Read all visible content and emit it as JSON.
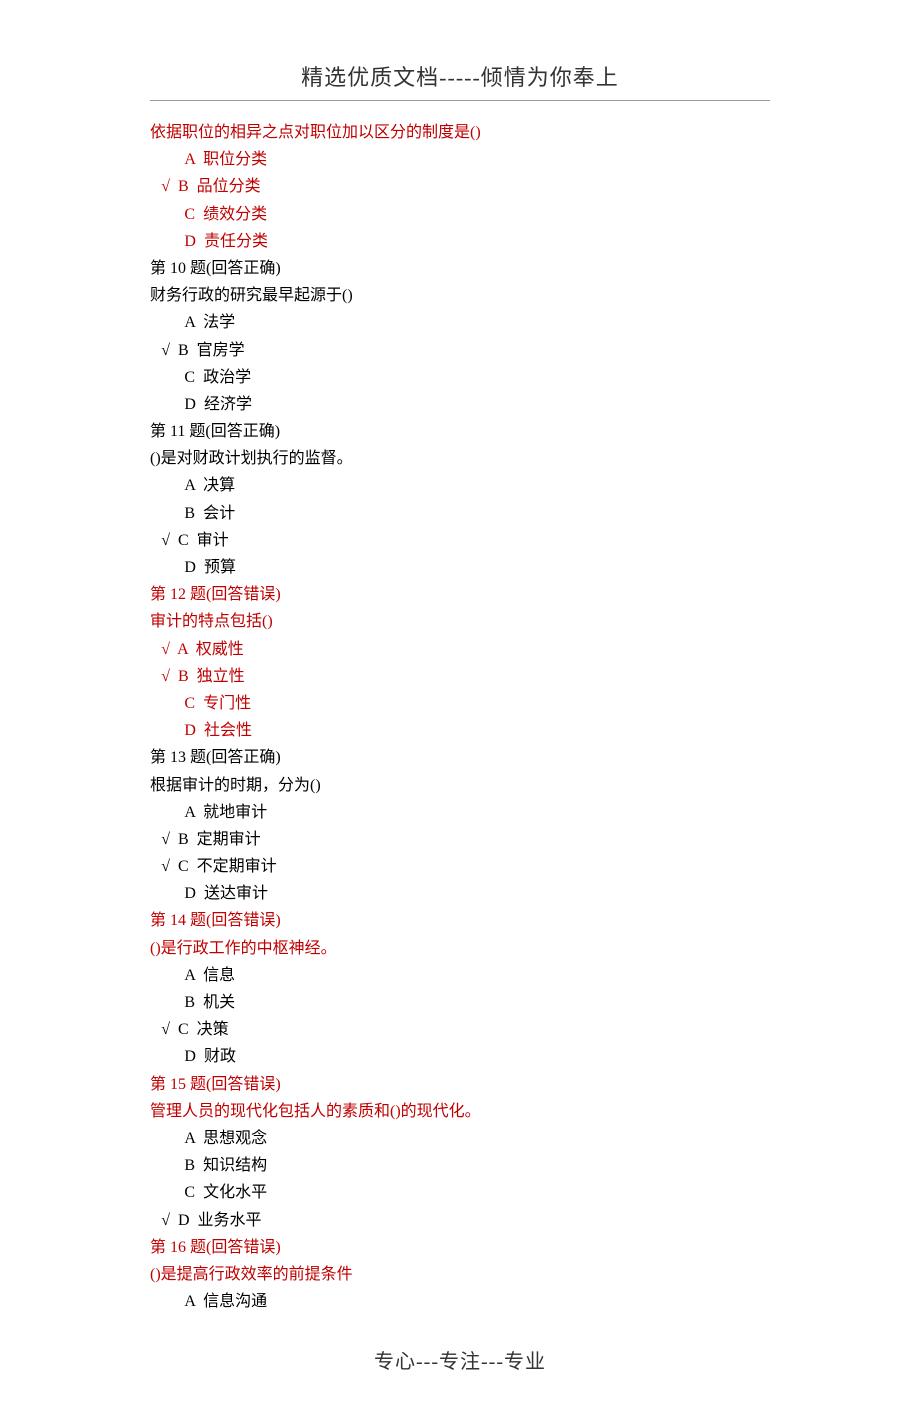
{
  "header": "精选优质文档-----倾情为你奉上",
  "footer": "专心---专注---专业",
  "orphan_question": {
    "text": "依据职位的相异之点对职位加以区分的制度是()",
    "text_color": "red",
    "options": [
      {
        "label": "A",
        "text": "职位分类",
        "marked": false,
        "color": "red"
      },
      {
        "label": "B",
        "text": "品位分类",
        "marked": true,
        "color": "red"
      },
      {
        "label": "C",
        "text": "绩效分类",
        "marked": false,
        "color": "red"
      },
      {
        "label": "D",
        "text": "责任分类",
        "marked": false,
        "color": "red"
      }
    ]
  },
  "questions": [
    {
      "header": "第 10 题(回答正确)",
      "header_color": "black",
      "text": "财务行政的研究最早起源于()",
      "text_color": "black",
      "options": [
        {
          "label": "A",
          "text": "法学",
          "marked": false,
          "color": "black"
        },
        {
          "label": "B",
          "text": "官房学",
          "marked": true,
          "color": "black"
        },
        {
          "label": "C",
          "text": "政治学",
          "marked": false,
          "color": "black"
        },
        {
          "label": "D",
          "text": "经济学",
          "marked": false,
          "color": "black"
        }
      ]
    },
    {
      "header": "第 11 题(回答正确)",
      "header_color": "black",
      "text": "()是对财政计划执行的监督。",
      "text_color": "black",
      "options": [
        {
          "label": "A",
          "text": "决算",
          "marked": false,
          "color": "black"
        },
        {
          "label": "B",
          "text": "会计",
          "marked": false,
          "color": "black"
        },
        {
          "label": "C",
          "text": "审计",
          "marked": true,
          "color": "black"
        },
        {
          "label": "D",
          "text": "预算",
          "marked": false,
          "color": "black"
        }
      ]
    },
    {
      "header": "第 12 题(回答错误)",
      "header_color": "red",
      "text": "审计的特点包括()",
      "text_color": "red",
      "options": [
        {
          "label": "A",
          "text": "权威性",
          "marked": true,
          "color": "red"
        },
        {
          "label": "B",
          "text": "独立性",
          "marked": true,
          "color": "red"
        },
        {
          "label": "C",
          "text": "专门性",
          "marked": false,
          "color": "red"
        },
        {
          "label": "D",
          "text": "社会性",
          "marked": false,
          "color": "red"
        }
      ]
    },
    {
      "header": "第 13 题(回答正确)",
      "header_color": "black",
      "text": "根据审计的时期，分为()",
      "text_color": "black",
      "options": [
        {
          "label": "A",
          "text": "就地审计",
          "marked": false,
          "color": "black"
        },
        {
          "label": "B",
          "text": "定期审计",
          "marked": true,
          "color": "black"
        },
        {
          "label": "C",
          "text": "不定期审计",
          "marked": true,
          "color": "black"
        },
        {
          "label": "D",
          "text": "送达审计",
          "marked": false,
          "color": "black"
        }
      ]
    },
    {
      "header": "第 14 题(回答错误)",
      "header_color": "red",
      "text": "()是行政工作的中枢神经。",
      "text_color": "red",
      "options": [
        {
          "label": "A",
          "text": "信息",
          "marked": false,
          "color": "black"
        },
        {
          "label": "B",
          "text": "机关",
          "marked": false,
          "color": "black"
        },
        {
          "label": "C",
          "text": "决策",
          "marked": true,
          "color": "black"
        },
        {
          "label": "D",
          "text": "财政",
          "marked": false,
          "color": "black"
        }
      ]
    },
    {
      "header": "第 15 题(回答错误)",
      "header_color": "red",
      "text": "管理人员的现代化包括人的素质和()的现代化。",
      "text_color": "red",
      "options": [
        {
          "label": "A",
          "text": "思想观念",
          "marked": false,
          "color": "black"
        },
        {
          "label": "B",
          "text": "知识结构",
          "marked": false,
          "color": "black"
        },
        {
          "label": "C",
          "text": "文化水平",
          "marked": false,
          "color": "black"
        },
        {
          "label": "D",
          "text": "业务水平",
          "marked": true,
          "color": "black"
        }
      ]
    },
    {
      "header": "第 16 题(回答错误)",
      "header_color": "red",
      "text": "()是提高行政效率的前提条件",
      "text_color": "red",
      "options": [
        {
          "label": "A",
          "text": "信息沟通",
          "marked": false,
          "color": "black"
        }
      ]
    }
  ]
}
